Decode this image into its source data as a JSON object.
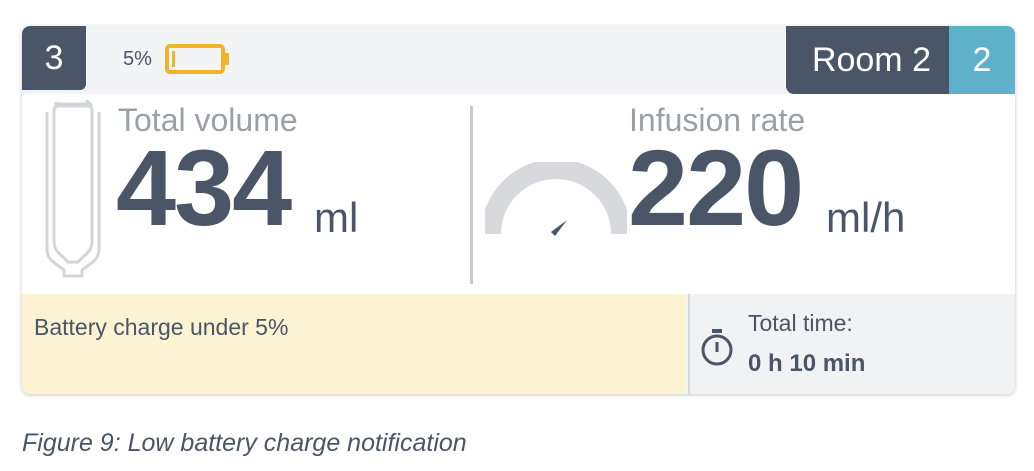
{
  "header": {
    "channel_number": "3",
    "battery_percent": "5%",
    "room_name": "Room 2",
    "room_number": "2"
  },
  "volume": {
    "label": "Total volume",
    "value": "434",
    "unit": "ml"
  },
  "rate": {
    "label": "Infusion rate",
    "value": "220",
    "unit": "ml/h"
  },
  "alert": {
    "text": "Battery charge under 5%"
  },
  "timer": {
    "label": "Total time:",
    "value": "0 h 10 min"
  },
  "caption": "Figure 9: Low battery charge notification",
  "icons": {
    "battery": "battery-low-icon",
    "bag": "infusion-bag-icon",
    "gauge": "rate-gauge-icon",
    "timer": "stopwatch-icon"
  },
  "colors": {
    "dark": "#4a5567",
    "accent": "#5fb0ca",
    "battery_warning": "#f0b428",
    "alert_background": "#fcf3d2",
    "muted_text": "#9aa0a8"
  },
  "battery_level": 0.05
}
